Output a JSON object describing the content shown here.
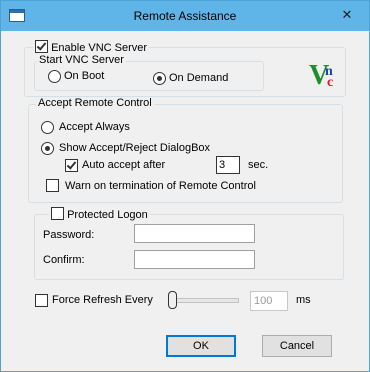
{
  "window": {
    "title": "Remote Assistance",
    "close_glyph": "✕"
  },
  "vnc_server": {
    "enable_label": "Enable VNC Server",
    "enable_checked": true,
    "start_group_label": "Start VNC Server",
    "on_boot_label": "On Boot",
    "on_demand_label": "On Demand",
    "selected_mode": "On Demand",
    "logo_letters": [
      "V",
      "n",
      "c"
    ]
  },
  "accept": {
    "group_label": "Accept Remote Control",
    "accept_always_label": "Accept Always",
    "show_dialog_label": "Show Accept/Reject DialogBox",
    "selected_option": "Show Accept/Reject DialogBox",
    "auto_accept_label": "Auto accept after",
    "auto_accept_checked": true,
    "auto_accept_seconds": "3",
    "seconds_unit": "sec.",
    "warn_label": "Warn on termination of Remote Control",
    "warn_checked": false
  },
  "logon": {
    "protected_label": "Protected Logon",
    "protected_checked": false,
    "password_label": "Password:",
    "password_value": "",
    "confirm_label": "Confirm:",
    "confirm_value": ""
  },
  "refresh": {
    "force_label": "Force Refresh Every",
    "force_checked": false,
    "interval_value": "100",
    "slider_level": 0,
    "unit": "ms"
  },
  "buttons": {
    "ok_label": "OK",
    "cancel_label": "Cancel"
  },
  "colors": {
    "title_bar": "#5fb4e8",
    "logo_green": "#1a8f2a",
    "logo_blue": "#1f3fae",
    "logo_red": "#d42020"
  },
  "icons": {
    "window_icon": "window-icon",
    "close": "close-icon",
    "logo": "vnc-logo-icon"
  }
}
